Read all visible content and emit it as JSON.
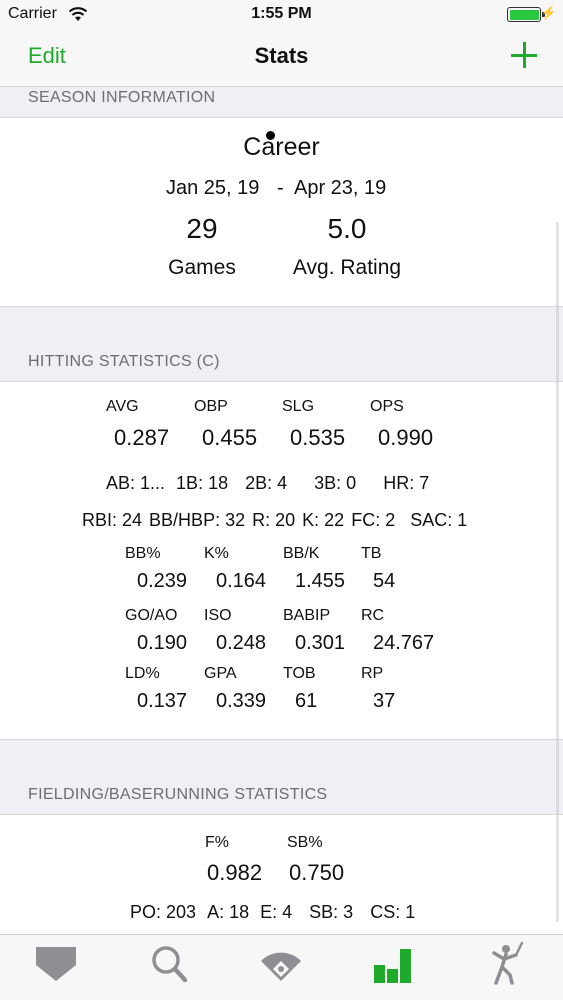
{
  "status": {
    "carrier": "Carrier",
    "time": "1:55 PM"
  },
  "nav": {
    "edit": "Edit",
    "title": "Stats"
  },
  "season": {
    "header": "SEASON INFORMATION",
    "name": "Career",
    "date_start": "Jan 25, 19",
    "date_sep": "-",
    "date_end": "Apr 23, 19",
    "games_value": "29",
    "games_label": "Games",
    "rating_value": "5.0",
    "rating_label": "Avg. Rating"
  },
  "hitting": {
    "header": "HITTING STATISTICS (C)",
    "main": [
      {
        "label": "AVG",
        "value": "0.287"
      },
      {
        "label": "OBP",
        "value": "0.455"
      },
      {
        "label": "SLG",
        "value": "0.535"
      },
      {
        "label": "OPS",
        "value": "0.990"
      }
    ],
    "counts1": [
      "AB: 1...",
      "1B: 18",
      "2B: 4",
      "3B: 0",
      "HR: 7"
    ],
    "counts2": [
      "RBI: 24",
      "BB/HBP: 32",
      "R: 20",
      "K: 22",
      "FC: 2",
      "SAC: 1"
    ],
    "grid": [
      [
        {
          "label": "BB%",
          "value": "0.239"
        },
        {
          "label": "K%",
          "value": "0.164"
        },
        {
          "label": "BB/K",
          "value": "1.455"
        },
        {
          "label": "TB",
          "value": "54"
        }
      ],
      [
        {
          "label": "GO/AO",
          "value": "0.190"
        },
        {
          "label": "ISO",
          "value": "0.248"
        },
        {
          "label": "BABIP",
          "value": "0.301"
        },
        {
          "label": "RC",
          "value": "24.767"
        }
      ],
      [
        {
          "label": "LD%",
          "value": "0.137"
        },
        {
          "label": "GPA",
          "value": "0.339"
        },
        {
          "label": "TOB",
          "value": "61"
        },
        {
          "label": "RP",
          "value": "37"
        }
      ]
    ]
  },
  "fielding": {
    "header": "FIELDING/BASERUNNING STATISTICS",
    "main": [
      {
        "label": "F%",
        "value": "0.982"
      },
      {
        "label": "SB%",
        "value": "0.750"
      }
    ],
    "counts": [
      "PO: 203",
      "A: 18",
      "E: 4",
      "SB: 3",
      "CS: 1"
    ]
  },
  "tabs": [
    {
      "name": "home-plate-icon",
      "selected": false
    },
    {
      "name": "search-icon",
      "selected": false
    },
    {
      "name": "baseball-field-icon",
      "selected": false
    },
    {
      "name": "stats-bar-chart-icon",
      "selected": true
    },
    {
      "name": "player-batting-icon",
      "selected": false
    }
  ],
  "colors": {
    "accent": "#1faa2b",
    "tab_inactive": "#8e8e93",
    "section_bg": "#efeff4"
  }
}
